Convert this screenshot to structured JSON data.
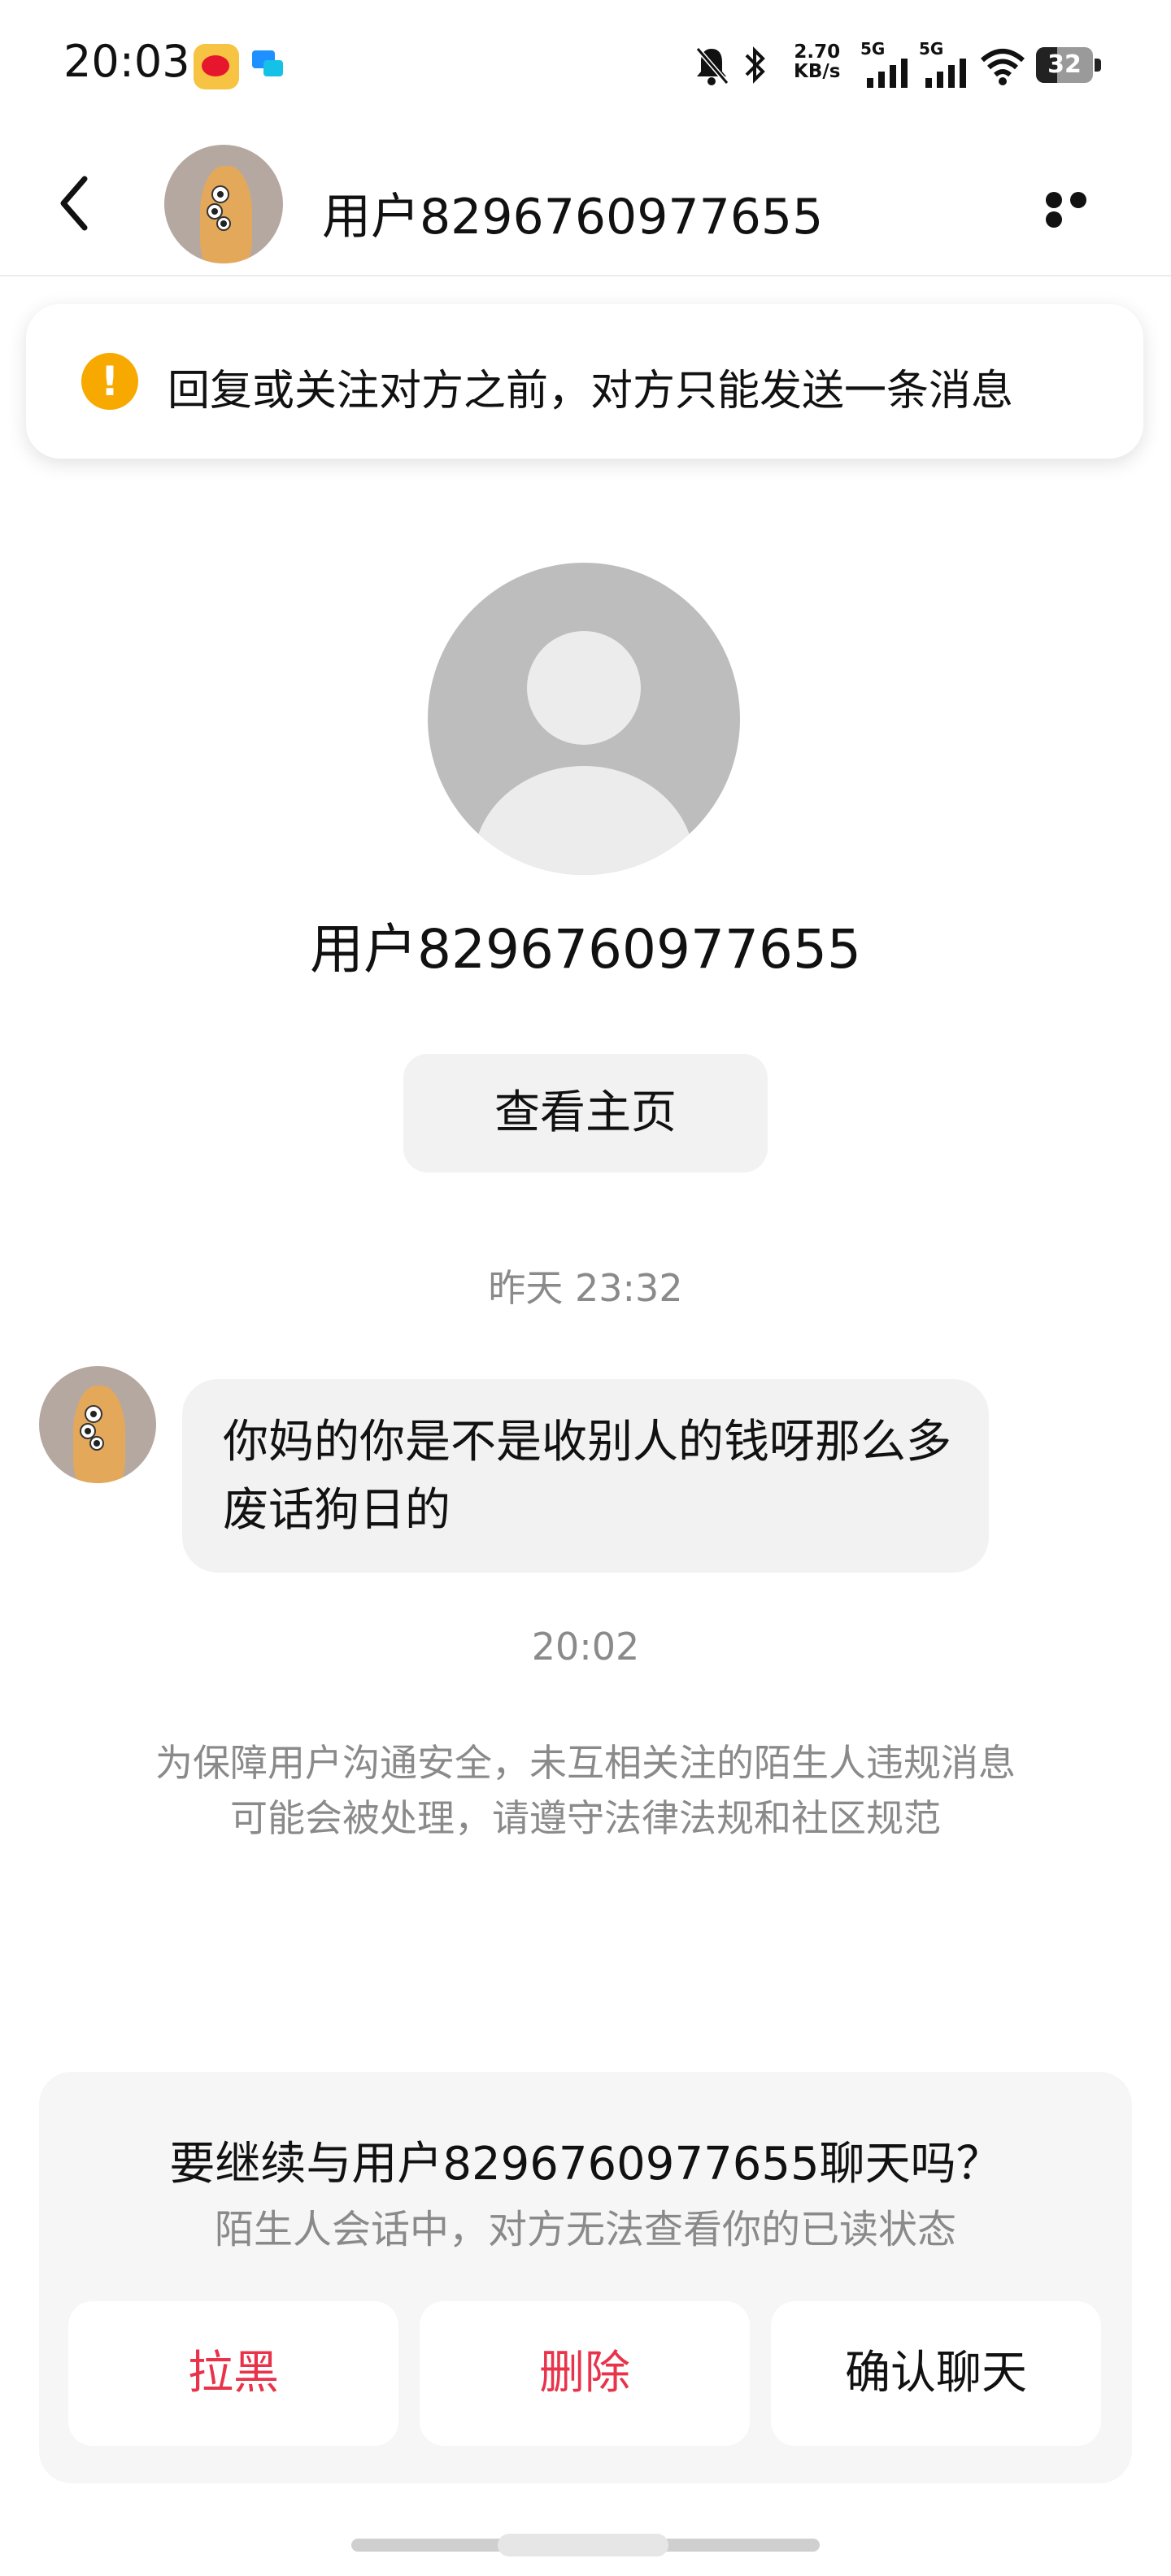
{
  "status_bar": {
    "time": "20:03",
    "net_speed_value": "2.70",
    "net_speed_unit": "KB/s",
    "signal_1_label": "5G",
    "signal_2_label": "5G",
    "battery": "32",
    "icons": [
      "weibo-app-icon",
      "message-app-icon",
      "mute-bell-icon",
      "bluetooth-icon",
      "signal-icon",
      "signal-icon",
      "wifi-icon",
      "battery-icon"
    ]
  },
  "header": {
    "title": "用户8296760977655",
    "back_icon": "chevron-left-icon",
    "more_icon": "more-dots-icon"
  },
  "notice": {
    "icon": "warning-icon",
    "text": "回复或关注对方之前，对方只能发送一条消息",
    "icon_color": "#F7A900"
  },
  "profile": {
    "name": "用户8296760977655",
    "view_homepage_label": "查看主页"
  },
  "messages": [
    {
      "timestamp": "昨天 23:32",
      "text": "你妈的你是不是收别人的钱呀那么多废话狗日的"
    }
  ],
  "second_timestamp": "20:02",
  "safety_notice": "为保障用户沟通安全，未互相关注的陌生人违规消息可能会被处理，请遵守法律法规和社区规范",
  "prompt_panel": {
    "title": "要继续与用户8296760977655聊天吗？",
    "subtitle": "陌生人会话中，对方无法查看你的已读状态",
    "actions": [
      {
        "label": "拉黑",
        "color": "#E8334A"
      },
      {
        "label": "删除",
        "color": "#E8334A"
      },
      {
        "label": "确认聊天",
        "color": "#111111"
      }
    ]
  }
}
